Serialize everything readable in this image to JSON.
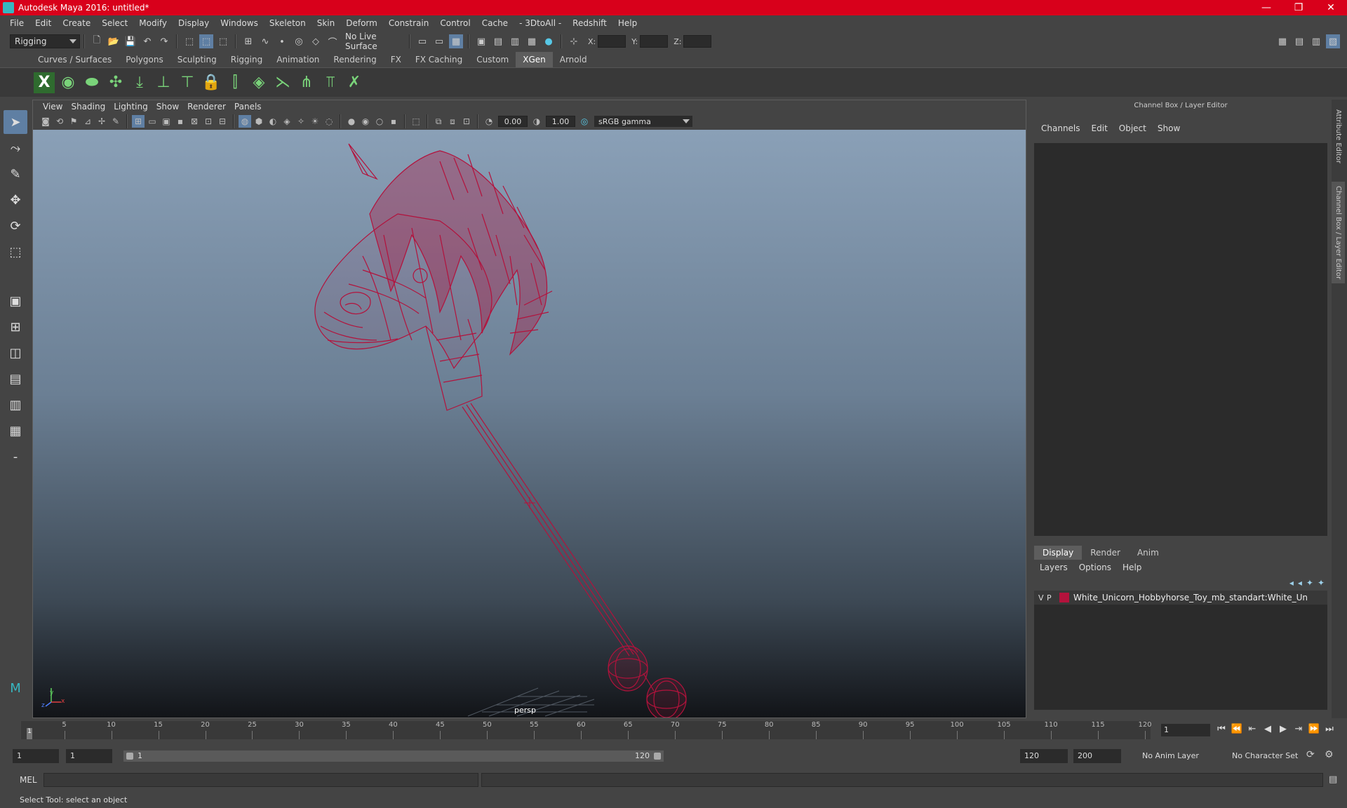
{
  "window": {
    "title": "Autodesk Maya 2016: untitled*",
    "min": "—",
    "max": "❐",
    "close": "✕"
  },
  "menubar": [
    "File",
    "Edit",
    "Create",
    "Select",
    "Modify",
    "Display",
    "Windows",
    "Skeleton",
    "Skin",
    "Deform",
    "Constrain",
    "Control",
    "Cache",
    "- 3DtoAll -",
    "Redshift",
    "Help"
  ],
  "status": {
    "menuset": "Rigging",
    "live_surface": "No Live Surface",
    "x_label": "X:",
    "y_label": "Y:",
    "z_label": "Z:"
  },
  "shelf": {
    "tabs": [
      "Curves / Surfaces",
      "Polygons",
      "Sculpting",
      "Rigging",
      "Animation",
      "Rendering",
      "FX",
      "FX Caching",
      "Custom",
      "XGen",
      "Arnold"
    ],
    "active_tab": "XGen"
  },
  "viewport": {
    "menu": [
      "View",
      "Shading",
      "Lighting",
      "Show",
      "Renderer",
      "Panels"
    ],
    "exposure": "0.00",
    "gamma_value": "1.00",
    "color_space": "sRGB gamma",
    "camera": "persp",
    "axis_x": "x",
    "axis_y": "y",
    "axis_z": "z",
    "wire_color": "#b3123c"
  },
  "channelbox": {
    "header": "Channel Box / Layer Editor",
    "menu": [
      "Channels",
      "Edit",
      "Object",
      "Show"
    ]
  },
  "layers": {
    "tabs": [
      "Display",
      "Render",
      "Anim"
    ],
    "active_tab": "Display",
    "menu": [
      "Layers",
      "Options",
      "Help"
    ],
    "rows": [
      {
        "v": "V",
        "p": "P",
        "name": "White_Unicorn_Hobbyhorse_Toy_mb_standart:White_Un",
        "color": "#b3123c"
      }
    ]
  },
  "side_tabs": [
    "Attribute Editor",
    "Channel Box / Layer Editor"
  ],
  "timeline": {
    "ticks": [
      1,
      5,
      10,
      15,
      20,
      25,
      30,
      35,
      40,
      45,
      50,
      55,
      60,
      65,
      70,
      75,
      80,
      85,
      90,
      95,
      100,
      105,
      110,
      115,
      120
    ],
    "current_frame": "1"
  },
  "range": {
    "start": "1",
    "anim_start": "1",
    "range_start": "1",
    "range_end": "120",
    "end": "120",
    "anim_end": "200",
    "anim_layer": "No Anim Layer",
    "char_set": "No Character Set"
  },
  "cmdline": {
    "label": "MEL"
  },
  "helpline": {
    "text": "Select Tool: select an object"
  }
}
